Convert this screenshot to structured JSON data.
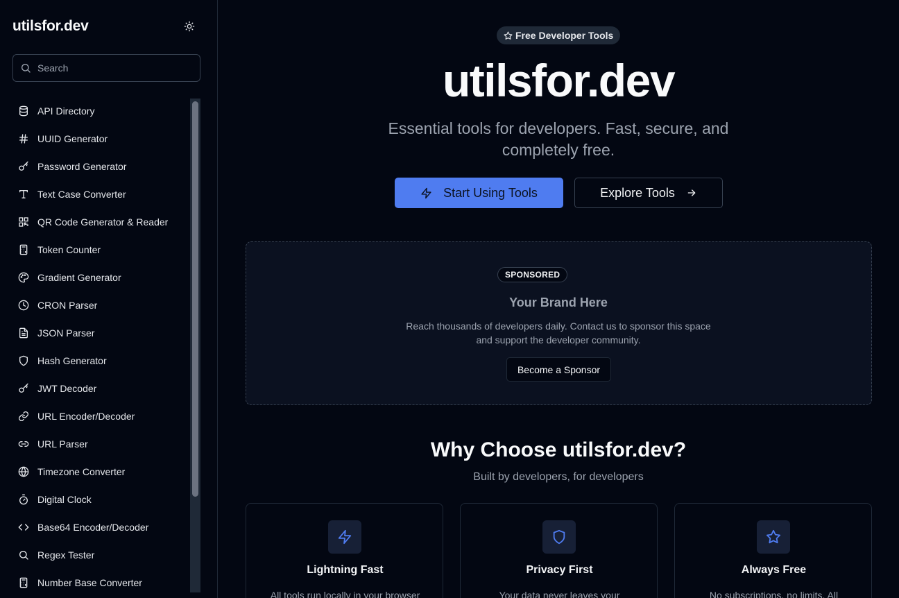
{
  "sidebar": {
    "brand": "utilsfor.dev",
    "search_placeholder": "Search",
    "items": [
      {
        "label": "API Directory"
      },
      {
        "label": "UUID Generator"
      },
      {
        "label": "Password Generator"
      },
      {
        "label": "Text Case Converter"
      },
      {
        "label": "QR Code Generator & Reader"
      },
      {
        "label": "Token Counter"
      },
      {
        "label": "Gradient Generator"
      },
      {
        "label": "CRON Parser"
      },
      {
        "label": "JSON Parser"
      },
      {
        "label": "Hash Generator"
      },
      {
        "label": "JWT Decoder"
      },
      {
        "label": "URL Encoder/Decoder"
      },
      {
        "label": "URL Parser"
      },
      {
        "label": "Timezone Converter"
      },
      {
        "label": "Digital Clock"
      },
      {
        "label": "Base64 Encoder/Decoder"
      },
      {
        "label": "Regex Tester"
      },
      {
        "label": "Number Base Converter"
      }
    ]
  },
  "hero": {
    "badge": "Free Developer Tools",
    "title": "utilsfor.dev",
    "subtitle": "Essential tools for developers. Fast, secure, and completely free.",
    "primary_button": "Start Using Tools",
    "secondary_button": "Explore Tools"
  },
  "sponsor": {
    "badge": "SPONSORED",
    "title": "Your Brand Here",
    "text": "Reach thousands of developers daily. Contact us to sponsor this space and support the developer community.",
    "button": "Become a Sponsor"
  },
  "why": {
    "title": "Why Choose utilsfor.dev?",
    "subtitle": "Built by developers, for developers",
    "cards": [
      {
        "title": "Lightning Fast",
        "text": "All tools run locally in your browser"
      },
      {
        "title": "Privacy First",
        "text": "Your data never leaves your"
      },
      {
        "title": "Always Free",
        "text": "No subscriptions, no limits. All"
      }
    ]
  },
  "colors": {
    "background": "#030712",
    "accent": "#4f7cf0",
    "muted_text": "#9ca3af",
    "border": "#374151"
  }
}
